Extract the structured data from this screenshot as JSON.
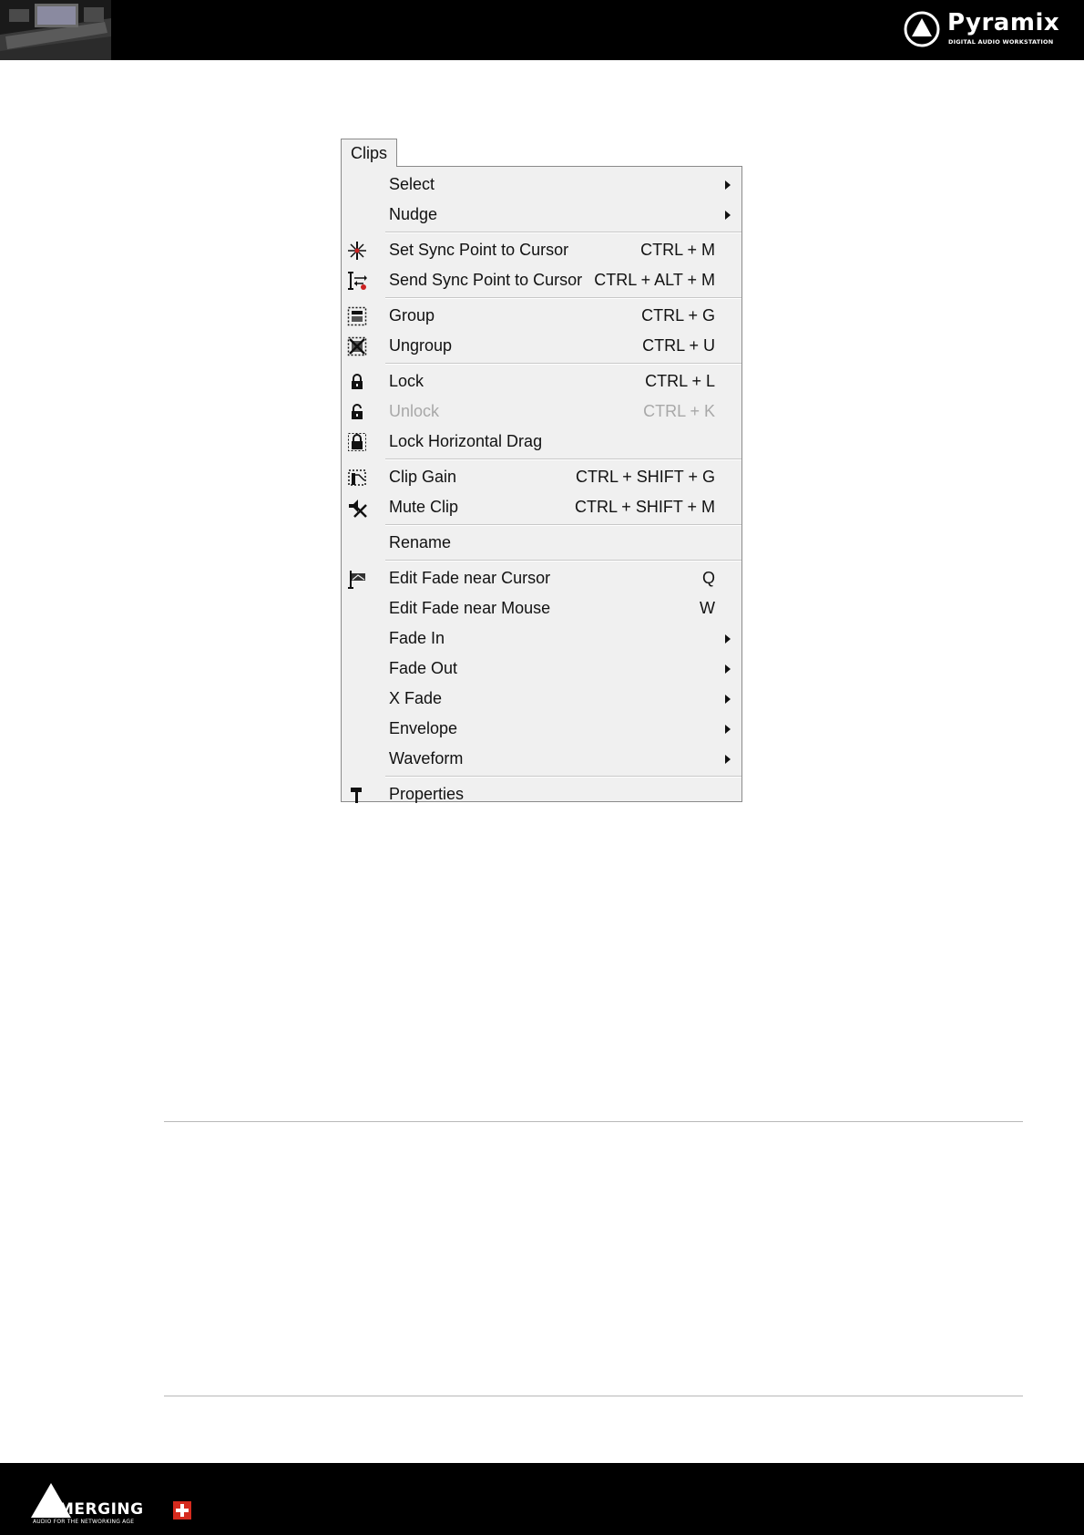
{
  "header": {
    "brand_name": "Pyramix",
    "brand_tagline": "DIGITAL AUDIO WORKSTATION"
  },
  "menu": {
    "tab_label": "Clips",
    "items": [
      {
        "label": "Select",
        "shortcut": "",
        "submenu": true,
        "icon": ""
      },
      {
        "label": "Nudge",
        "shortcut": "",
        "submenu": true,
        "icon": ""
      },
      {
        "label": "Set Sync Point to Cursor",
        "shortcut": "CTRL + M",
        "icon": "sync-point-icon"
      },
      {
        "label": "Send Sync Point to Cursor",
        "shortcut": "CTRL + ALT + M",
        "icon": "send-sync-icon"
      },
      {
        "label": "Group",
        "shortcut": "CTRL + G",
        "icon": "group-icon"
      },
      {
        "label": "Ungroup",
        "shortcut": "CTRL + U",
        "icon": "ungroup-icon"
      },
      {
        "label": "Lock",
        "shortcut": "CTRL + L",
        "icon": "lock-icon"
      },
      {
        "label": "Unlock",
        "shortcut": "CTRL + K",
        "icon": "unlock-icon",
        "disabled": true
      },
      {
        "label": "Lock Horizontal Drag",
        "shortcut": "",
        "icon": "lock-horizontal-icon"
      },
      {
        "label": "Clip Gain",
        "shortcut": "CTRL + SHIFT + G",
        "icon": "clip-gain-icon"
      },
      {
        "label": "Mute Clip",
        "shortcut": "CTRL + SHIFT + M",
        "icon": "mute-clip-icon"
      },
      {
        "label": "Rename",
        "shortcut": "",
        "icon": ""
      },
      {
        "label": "Edit Fade near Cursor",
        "shortcut": "Q",
        "icon": "edit-fade-icon"
      },
      {
        "label": "Edit Fade near Mouse",
        "shortcut": "W",
        "icon": ""
      },
      {
        "label": "Fade In",
        "shortcut": "",
        "submenu": true,
        "icon": ""
      },
      {
        "label": "Fade Out",
        "shortcut": "",
        "submenu": true,
        "icon": ""
      },
      {
        "label": "X Fade",
        "shortcut": "",
        "submenu": true,
        "icon": ""
      },
      {
        "label": "Envelope",
        "shortcut": "",
        "submenu": true,
        "icon": ""
      },
      {
        "label": "Waveform",
        "shortcut": "",
        "submenu": true,
        "icon": ""
      },
      {
        "label": "Properties",
        "shortcut": "",
        "icon": "hammer-icon"
      }
    ]
  },
  "footer": {
    "brand_name": "MERGING",
    "brand_tagline": "AUDIO FOR THE NETWORKING AGE"
  }
}
